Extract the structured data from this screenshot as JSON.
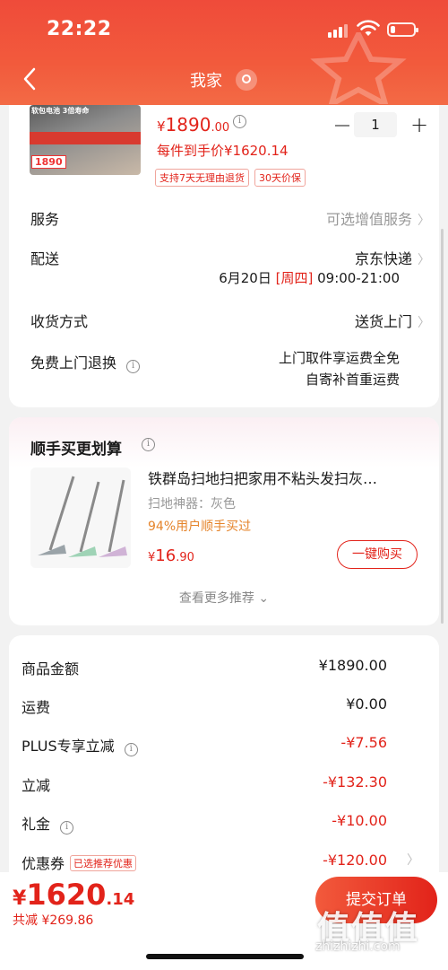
{
  "status_bar": {
    "time": "22:22"
  },
  "nav": {
    "title": "我家"
  },
  "product": {
    "image_text_top": "软包电池 3倍寿命",
    "image_price": "1890",
    "price_symbol": "¥",
    "price_int": "1890",
    "price_dec": ".00",
    "arrival_text": "每件到手价¥1620.14",
    "quantity": "1",
    "badges": [
      "支持7天无理由退货",
      "30天价保"
    ]
  },
  "order_options": {
    "service": {
      "label": "服务",
      "value": "可选增值服务"
    },
    "delivery": {
      "label": "配送",
      "value": "京东快递",
      "date": "6月20日",
      "weekday": "[周四]",
      "time": "09:00-21:00"
    },
    "receive": {
      "label": "收货方式",
      "value": "送货上门"
    },
    "free_return": {
      "label": "免费上门退换",
      "line1": "上门取件享运费全免",
      "line2": "自寄补首重运费"
    }
  },
  "recommend": {
    "title": "顺手买更划算",
    "item_name": "铁群岛扫地扫把家用不粘头发扫灰…",
    "spec": "扫地神器：灰色",
    "bought_pct": "94%用户顺手买过",
    "price_symbol": "¥",
    "price_int": "16",
    "price_dec": ".90",
    "buy_label": "一键购买",
    "more_label": "查看更多推荐"
  },
  "summary": {
    "rows": [
      {
        "label": "商品金额",
        "value": "¥1890.00"
      },
      {
        "label": "运费",
        "value": "¥0.00"
      },
      {
        "label": "PLUS专享立减",
        "value": "-¥7.56"
      },
      {
        "label": "立减",
        "value": "-¥132.30"
      },
      {
        "label": "礼金",
        "value": "-¥10.00"
      },
      {
        "label": "优惠券",
        "value": "-¥120.00",
        "tag": "已选推荐优惠"
      }
    ]
  },
  "bottom": {
    "total_symbol": "¥",
    "total_int": "1620",
    "total_dec": ".14",
    "saved": "共减 ¥269.86",
    "submit_label": "提交订单"
  },
  "watermark": {
    "logo": "值值值",
    "url": "zhizhizhi.com"
  },
  "colors": {
    "brand_red": "#e2231a",
    "header": "#f25a3c",
    "orange": "#e5842b"
  }
}
